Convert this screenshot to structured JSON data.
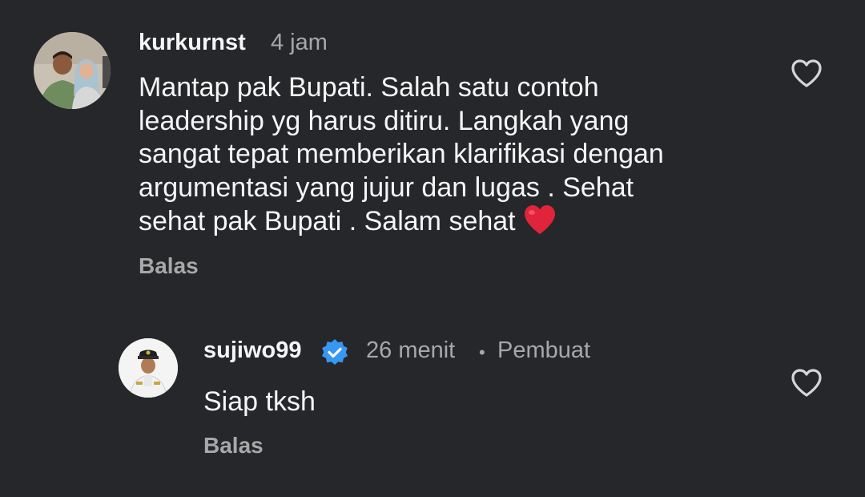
{
  "comments": [
    {
      "username": "kurkurnst",
      "time": "4 jam",
      "text_lines": [
        "Mantap pak Bupati. Salah satu contoh",
        "leadership yg harus ditiru. Langkah yang",
        "sangat tepat memberikan klarifikasi dengan",
        "argumentasi yang jujur dan lugas . Sehat",
        "sehat pak Bupati . Salam sehat"
      ],
      "reply_label": "Balas",
      "like_icon": "heart-outline-icon"
    },
    {
      "username": "sujiwo99",
      "verified": true,
      "time": "26 menit",
      "separator": "•",
      "author_tag": "Pembuat",
      "text": "Siap tksh",
      "reply_label": "Balas",
      "like_icon": "heart-outline-icon"
    }
  ],
  "colors": {
    "background": "#25272b",
    "primary_text": "#f5f5f5",
    "secondary_text": "#a8a8a8",
    "verified_blue": "#3897f0",
    "heart_red": "#e0243a"
  }
}
